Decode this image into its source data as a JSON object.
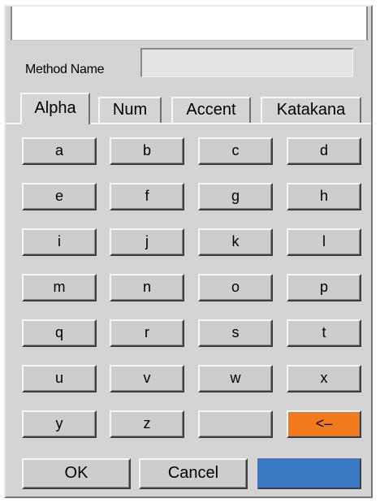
{
  "form": {
    "title_value": "",
    "method_name_label": "Method Name",
    "method_name_value": ""
  },
  "tabs": [
    {
      "label": "Alpha",
      "active": true
    },
    {
      "label": "Num",
      "active": false
    },
    {
      "label": "Accent",
      "active": false
    },
    {
      "label": "Katakana",
      "active": false
    }
  ],
  "keys": [
    [
      "a",
      "b",
      "c",
      "d"
    ],
    [
      "e",
      "f",
      "g",
      "h"
    ],
    [
      "i",
      "j",
      "k",
      "l"
    ],
    [
      "m",
      "n",
      "o",
      "p"
    ],
    [
      "q",
      "r",
      "s",
      "t"
    ],
    [
      "u",
      "v",
      "w",
      "x"
    ],
    [
      "y",
      "z",
      "",
      "<–"
    ]
  ],
  "buttons": {
    "ok_label": "OK",
    "cancel_label": "Cancel",
    "blue_label": ""
  },
  "colors": {
    "backspace_key": "#f27a1c",
    "blue_button": "#3a78c4",
    "dialog_bg": "#d4d4d4"
  }
}
